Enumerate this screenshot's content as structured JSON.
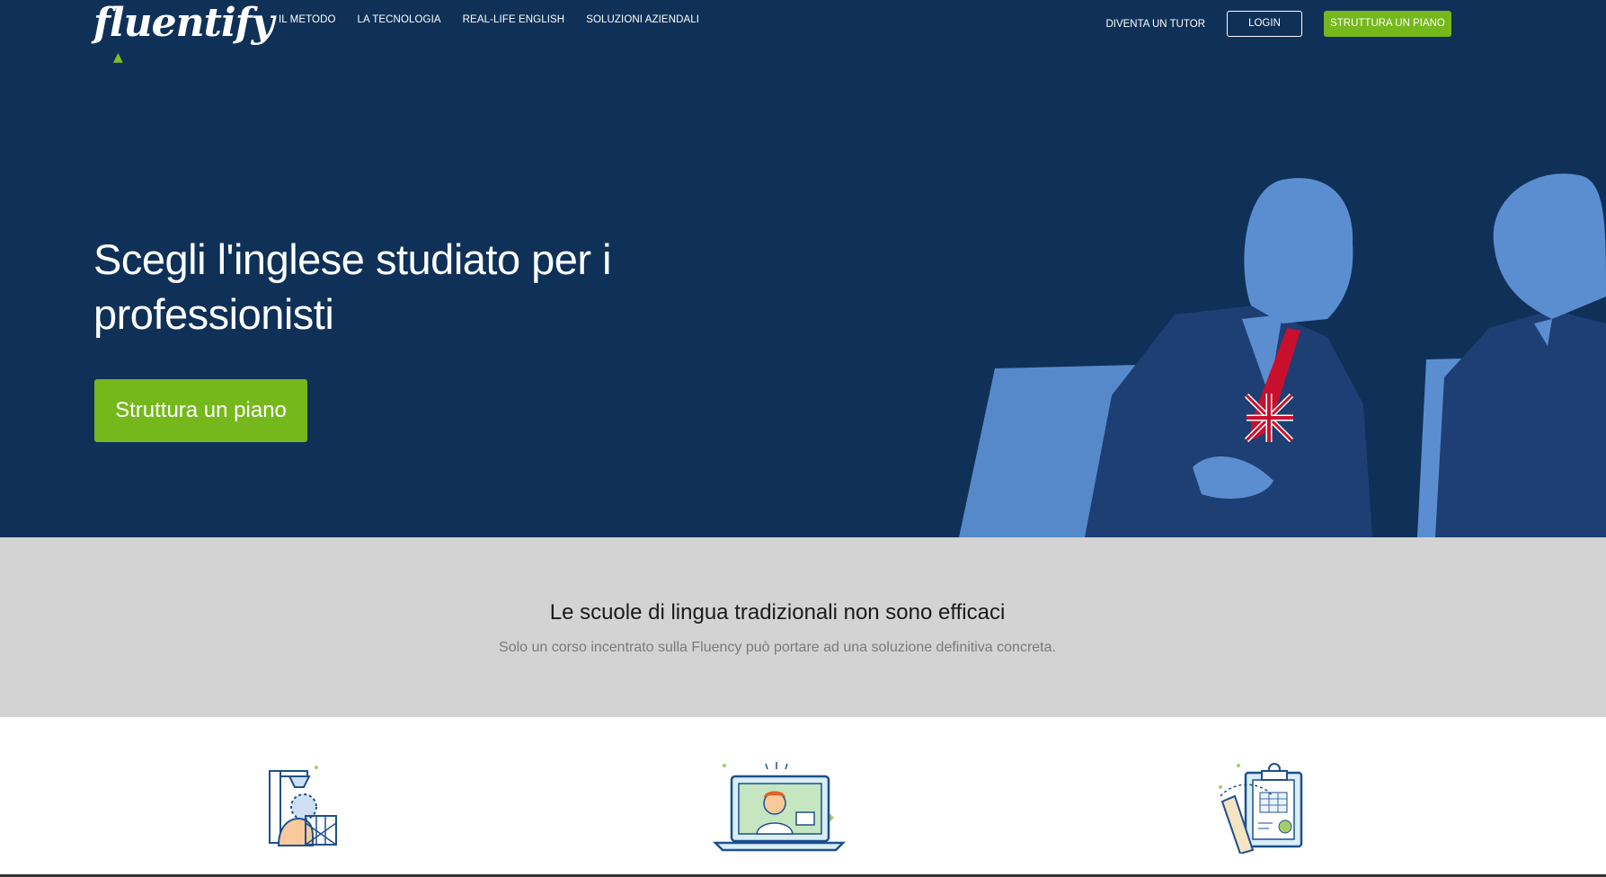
{
  "nav": {
    "logo": "fluentify",
    "links": [
      "IL METODO",
      "LA TECNOLOGIA",
      "REAL-LIFE ENGLISH",
      "SOLUZIONI AZIENDALI"
    ],
    "tutor": "DIVENTA UN TUTOR",
    "login": "LOGIN",
    "plan": "STRUTTURA UN PIANO"
  },
  "hero": {
    "title": "Scegli l'inglese studiato per i professionisti",
    "cta": "Struttura un piano"
  },
  "band": {
    "title": "Le scuole di lingua tradizionali non sono efficaci",
    "subtitle": "Solo un corso incentrato sulla Fluency può portare ad una soluzione definitiva concreta."
  },
  "colors": {
    "hero_bg": "#0f3158",
    "accent": "#74b81b",
    "band_bg": "#d3d3d3",
    "illustration_blue": "#5b8ed1"
  },
  "icons": [
    "basketball-player-icon",
    "laptop-video-call-icon",
    "clipboard-plan-icon"
  ]
}
